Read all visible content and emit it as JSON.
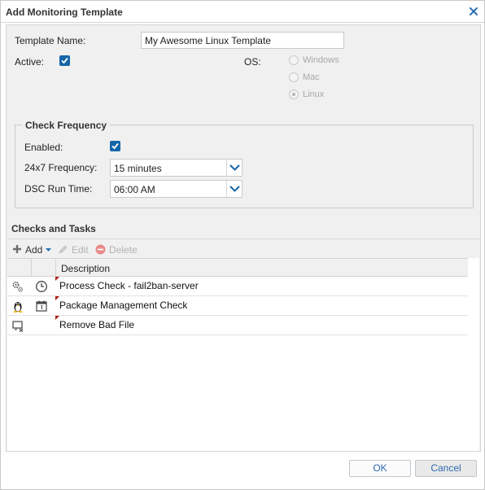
{
  "dialog": {
    "title": "Add Monitoring Template"
  },
  "form": {
    "template_name_label": "Template Name:",
    "template_name_value": "My Awesome Linux Template",
    "active_label": "Active:",
    "active_checked": true,
    "os_label": "OS:",
    "os_options": [
      {
        "label": "Windows",
        "selected": false
      },
      {
        "label": "Mac",
        "selected": false
      },
      {
        "label": "Linux",
        "selected": true
      }
    ]
  },
  "check_frequency": {
    "legend": "Check Frequency",
    "enabled_label": "Enabled:",
    "enabled_checked": true,
    "frequency_label": "24x7 Frequency:",
    "frequency_value": "15 minutes",
    "dsc_label": "DSC Run Time:",
    "dsc_value": "06:00 AM"
  },
  "checks_tasks": {
    "title": "Checks and Tasks",
    "toolbar": {
      "add_label": "Add",
      "edit_label": "Edit",
      "delete_label": "Delete"
    },
    "columns": {
      "description": "Description"
    },
    "rows": [
      {
        "icon1": "gears-icon",
        "icon2": "clock-icon",
        "description": "Process Check - fail2ban-server"
      },
      {
        "icon1": "linux-tux-icon",
        "icon2": "calendar-icon",
        "description": "Package Management Check"
      },
      {
        "icon1": "remove-file-icon",
        "icon2": "",
        "description": "Remove Bad File"
      }
    ]
  },
  "footer": {
    "ok_label": "OK",
    "cancel_label": "Cancel"
  },
  "colors": {
    "accent": "#1565a8",
    "dirty_marker": "#b01818",
    "delete_icon": "#e88a8a",
    "add_icon": "#6d6d6d"
  }
}
